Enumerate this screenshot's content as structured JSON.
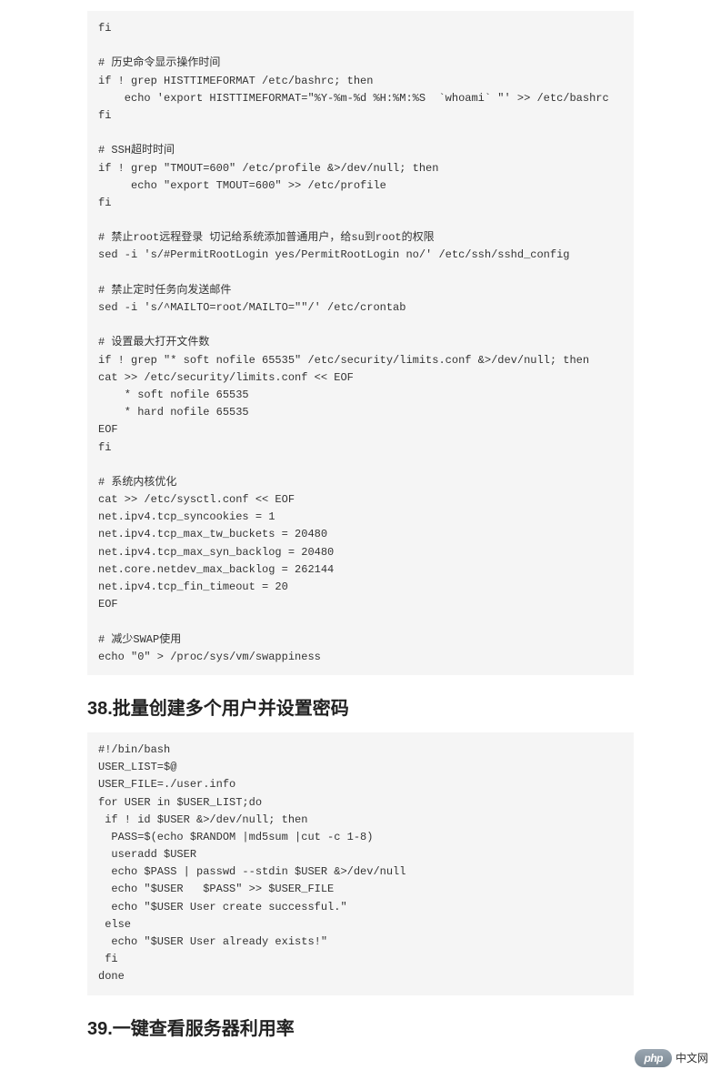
{
  "code_block_1": "fi\n\n# 历史命令显示操作时间\nif ! grep HISTTIMEFORMAT /etc/bashrc; then\n    echo 'export HISTTIMEFORMAT=\"%Y-%m-%d %H:%M:%S  `whoami` \"' >> /etc/bashrc\nfi\n\n# SSH超时时间\nif ! grep \"TMOUT=600\" /etc/profile &>/dev/null; then\n     echo \"export TMOUT=600\" >> /etc/profile\nfi\n\n# 禁止root远程登录 切记给系统添加普通用户，给su到root的权限\nsed -i 's/#PermitRootLogin yes/PermitRootLogin no/' /etc/ssh/sshd_config\n\n# 禁止定时任务向发送邮件\nsed -i 's/^MAILTO=root/MAILTO=\"\"/' /etc/crontab\n\n# 设置最大打开文件数\nif ! grep \"* soft nofile 65535\" /etc/security/limits.conf &>/dev/null; then\ncat >> /etc/security/limits.conf << EOF\n    * soft nofile 65535\n    * hard nofile 65535\nEOF\nfi\n\n# 系统内核优化\ncat >> /etc/sysctl.conf << EOF\nnet.ipv4.tcp_syncookies = 1\nnet.ipv4.tcp_max_tw_buckets = 20480\nnet.ipv4.tcp_max_syn_backlog = 20480\nnet.core.netdev_max_backlog = 262144\nnet.ipv4.tcp_fin_timeout = 20\nEOF\n\n# 减少SWAP使用\necho \"0\" > /proc/sys/vm/swappiness",
  "heading_38": "38.批量创建多个用户并设置密码",
  "code_block_2": "#!/bin/bash\nUSER_LIST=$@\nUSER_FILE=./user.info\nfor USER in $USER_LIST;do\n if ! id $USER &>/dev/null; then\n  PASS=$(echo $RANDOM |md5sum |cut -c 1-8)\n  useradd $USER\n  echo $PASS | passwd --stdin $USER &>/dev/null\n  echo \"$USER   $PASS\" >> $USER_FILE\n  echo \"$USER User create successful.\"\n else\n  echo \"$USER User already exists!\"\n fi\ndone",
  "heading_39": "39.一键查看服务器利用率",
  "footer": {
    "php": "php",
    "cn": "中文网"
  }
}
